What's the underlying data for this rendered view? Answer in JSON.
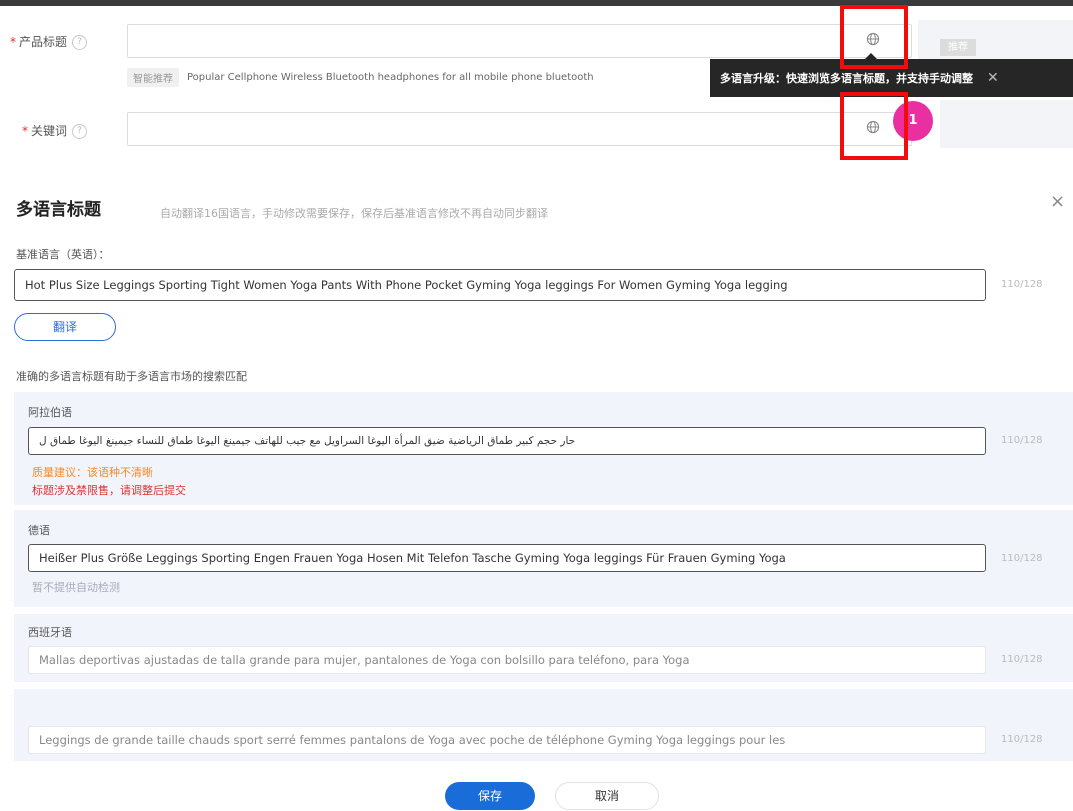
{
  "top_form": {
    "product_title_label": "产品标题",
    "keywords_label": "关键词",
    "smart_recommend_tag": "智能推荐",
    "suggestion_text": "Popular Cellphone Wireless Bluetooth headphones for all mobile phone bluetooth",
    "side_tag": "推荐",
    "tooltip_text": "多语言升级：快速浏览多语言标题，并支持手动调整",
    "tooltip_close": "✕",
    "badge_number": "1"
  },
  "modal": {
    "title": "多语言标题",
    "subtitle": "自动翻译16国语言，手动修改需要保存，保存后基准语言修改不再自动同步翻译",
    "close": "×",
    "base_language_label": "基准语言（英语）：",
    "base_title_value": "Hot Plus Size Leggings Sporting Tight Women Yoga Pants With Phone Pocket Gyming Yoga leggings For Women Gyming Yoga legging",
    "base_count": "110/128",
    "translate_button": "翻译",
    "accuracy_hint": "准确的多语言标题有助于多语言市场的搜索匹配",
    "languages": [
      {
        "name": "阿拉伯语",
        "value": "حار حجم كبير طماق الرياضية ضيق المرأة اليوغا السراويل مع جيب للهاتف جيمينغ اليوغا طماق للنساء جيمينغ اليوغا طماق ل",
        "count": "110/128",
        "warning_orange": "质量建议：该语种不清晰",
        "warning_red": "标题涉及禁限售，请调整后提交"
      },
      {
        "name": "德语",
        "value": "Heißer Plus Größe Leggings Sporting Engen Frauen Yoga Hosen Mit Telefon Tasche Gyming Yoga leggings Für Frauen Gyming Yoga",
        "count": "110/128",
        "hint": "暂不提供自动检测"
      },
      {
        "name": "西班牙语",
        "value": "Mallas deportivas ajustadas de talla grande para mujer, pantalones de Yoga con bolsillo para teléfono, para Yoga",
        "count": "110/128"
      },
      {
        "name": "",
        "value": "Leggings de grande taille chauds sport serré femmes pantalons de Yoga avec poche de téléphone Gyming Yoga leggings pour les",
        "count": "110/128"
      }
    ],
    "save_button": "保存",
    "cancel_button": "取消"
  },
  "colors": {
    "highlight": "#f20d0d",
    "primary": "#1a6dd9",
    "badge": "#ea2fa0",
    "tooltip_bg": "#262626",
    "section_bg": "#f2f4fb"
  }
}
